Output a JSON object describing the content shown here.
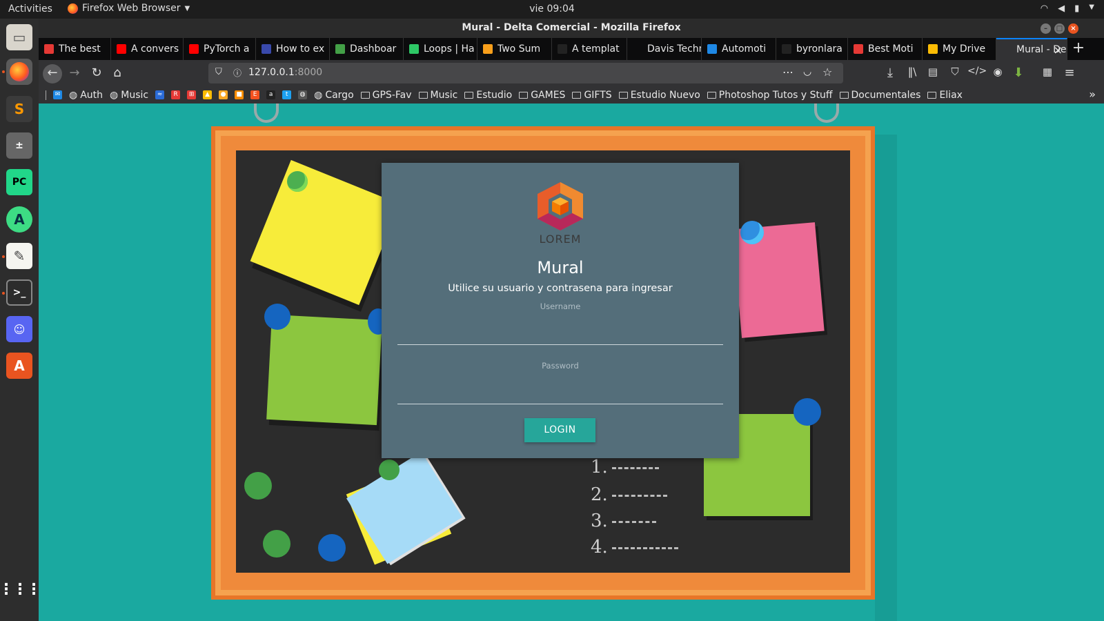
{
  "system": {
    "activities": "Activities",
    "app_menu": "Firefox Web Browser",
    "clock": "vie 09:04"
  },
  "window": {
    "title": "Mural - Delta Comercial - Mozilla Firefox"
  },
  "tabs": [
    {
      "label": "The best",
      "color": "#e53935",
      "icon": "brave-icon"
    },
    {
      "label": "A convers",
      "color": "#ff0000",
      "icon": "youtube-icon"
    },
    {
      "label": "PyTorch a",
      "color": "#ff0000",
      "icon": "youtube-icon"
    },
    {
      "label": "How to ex",
      "color": "#3949ab",
      "icon": "atlas-icon"
    },
    {
      "label": "Dashboar",
      "color": "#43a047",
      "icon": "check-icon"
    },
    {
      "label": "Loops | Ha",
      "color": "#2ec866",
      "icon": "hackerrank-icon"
    },
    {
      "label": "Two Sum",
      "color": "#f89f1b",
      "icon": "leetcode-icon"
    },
    {
      "label": "A templat",
      "color": "#222222",
      "icon": "github-icon"
    },
    {
      "label": "Davis Technic",
      "color": "#0c0c0d",
      "icon": "blank-icon"
    },
    {
      "label": "Automoti",
      "color": "#1e88e5",
      "icon": "info-icon"
    },
    {
      "label": "byronlara",
      "color": "#222222",
      "icon": "github-icon"
    },
    {
      "label": "Best Moti",
      "color": "#e53935",
      "icon": "pdf-icon"
    },
    {
      "label": "My Drive",
      "color": "#fbbc04",
      "icon": "drive-icon"
    },
    {
      "label": "Mural - De",
      "color": "#323234",
      "icon": "blank-icon"
    }
  ],
  "url": {
    "host": "127.0.0.1",
    "port": ":8000"
  },
  "bookmarks": [
    {
      "label": "Auth",
      "kind": "globe"
    },
    {
      "label": "Music",
      "kind": "globe"
    },
    {
      "label": "Cargo",
      "kind": "globe"
    },
    {
      "label": "GPS-Fav",
      "kind": "folder"
    },
    {
      "label": "Music",
      "kind": "folder"
    },
    {
      "label": "Estudio",
      "kind": "folder"
    },
    {
      "label": "GAMES",
      "kind": "folder"
    },
    {
      "label": "GIFTS",
      "kind": "folder"
    },
    {
      "label": "Estudio Nuevo",
      "kind": "folder"
    },
    {
      "label": "Photoshop Tutos y Stuff",
      "kind": "folder"
    },
    {
      "label": "Documentales",
      "kind": "folder"
    },
    {
      "label": "Eliax",
      "kind": "folder"
    }
  ],
  "chalkboard_list": [
    "1.",
    "2.",
    "3.",
    "4."
  ],
  "login": {
    "logo_text": "LOREM",
    "title": "Mural",
    "subtitle": "Utilice su usuario y contrasena para ingresar",
    "username_label": "Username",
    "username_value": "",
    "password_label": "Password",
    "password_value": "",
    "button_label": "LOGIN"
  }
}
